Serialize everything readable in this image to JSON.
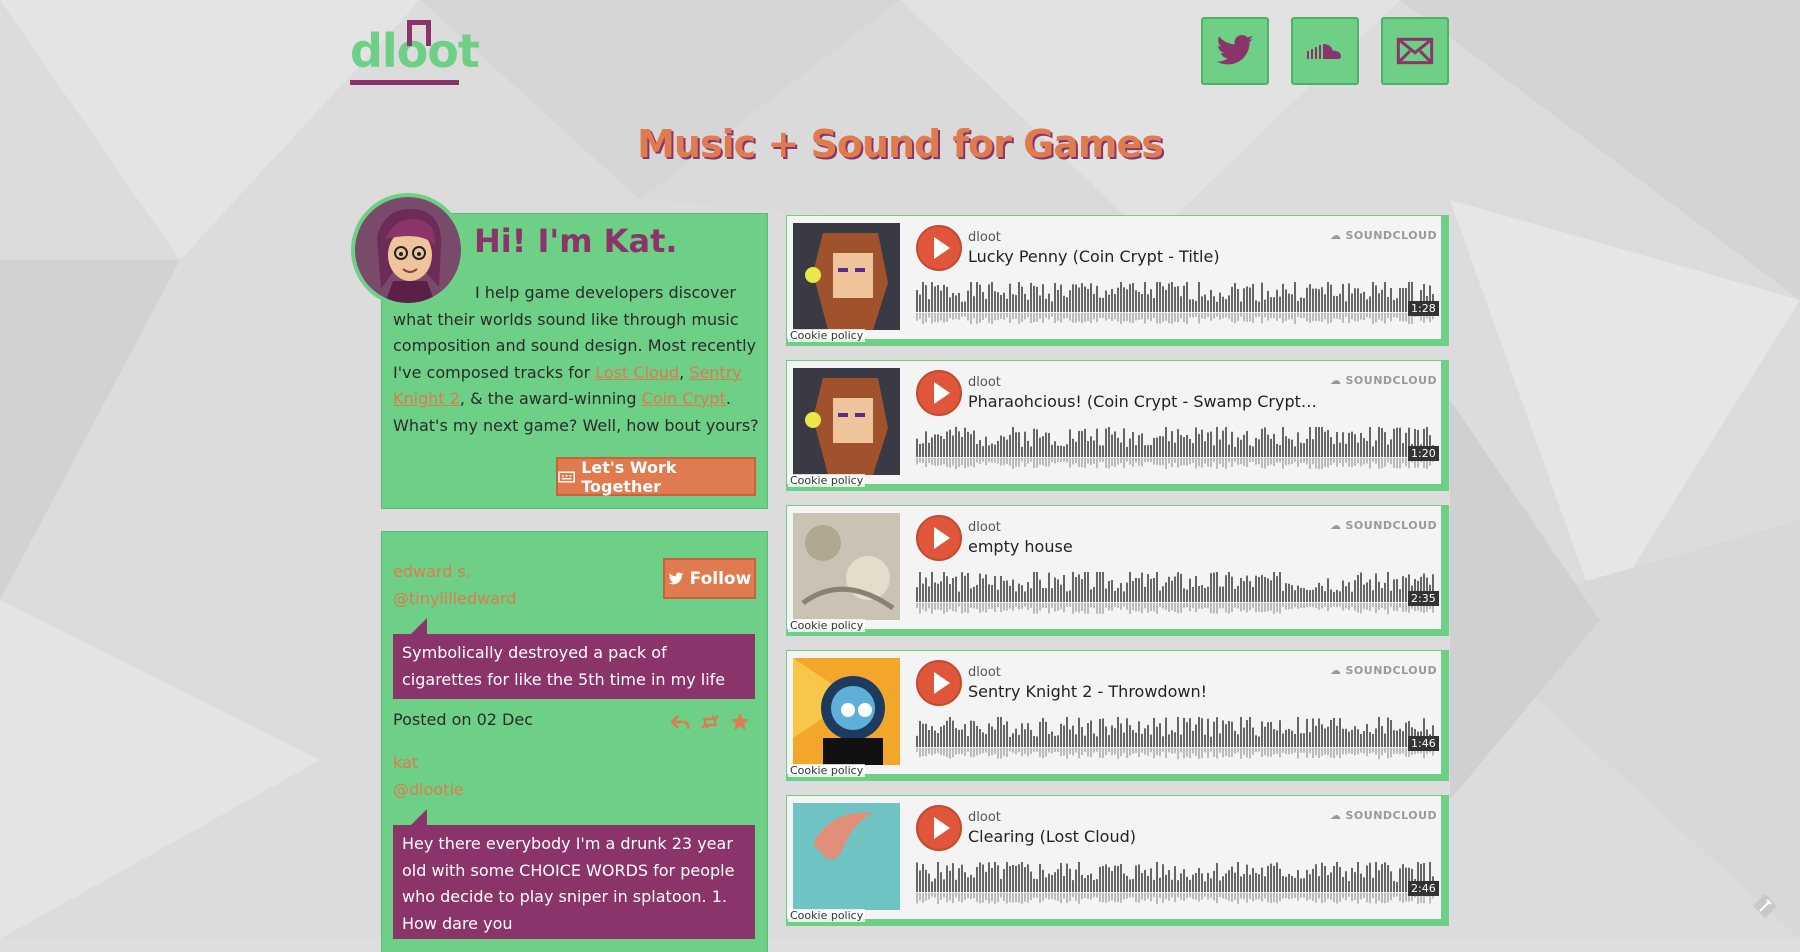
{
  "logo": {
    "text": "dloot"
  },
  "social": {
    "twitter": {
      "icon": "twitter-icon"
    },
    "soundcloud": {
      "icon": "soundcloud-icon"
    },
    "email": {
      "icon": "mail-icon"
    }
  },
  "headline": "Music + Sound for Games",
  "intro": {
    "greeting": "Hi! I'm Kat.",
    "text_before": "I help game developers discover what their worlds sound like through music composition and sound design. Most recently I've composed tracks for ",
    "link1": "Lost Cloud",
    "sep1": ", ",
    "link2": "Sentry Knight 2",
    "sep2": ", & the award-winning ",
    "link3": "Coin Crypt",
    "text_after": ". What's my next game? Well, how bout yours?",
    "cta": "Let's Work Together"
  },
  "feed": {
    "follow_label": "Follow",
    "tweets": [
      {
        "name": "edward s.",
        "handle": "@tinylilledward",
        "text": "Symbolically destroyed a pack of cigarettes for like the 5th time in my life",
        "posted": "Posted on 02 Dec"
      },
      {
        "name": "kat",
        "handle": "@dlootie",
        "text": "Hey there everybody I'm a drunk 23 year old with some CHOICE WORDS for people who decide to play sniper in splatoon. 1. How dare you"
      }
    ]
  },
  "tracks": [
    {
      "user": "dloot",
      "title": "Lucky Penny (Coin Crypt - Title)",
      "duration": "1:28",
      "brand": "SOUNDCLOUD",
      "cookie": "Cookie policy"
    },
    {
      "user": "dloot",
      "title": "Pharaohcious! (Coin Crypt - Swamp Crypt The...",
      "duration": "1:20",
      "brand": "SOUNDCLOUD",
      "cookie": "Cookie policy"
    },
    {
      "user": "dloot",
      "title": "empty house",
      "duration": "2:35",
      "brand": "SOUNDCLOUD",
      "cookie": "Cookie policy"
    },
    {
      "user": "dloot",
      "title": "Sentry Knight 2 - Throwdown!",
      "duration": "1:46",
      "brand": "SOUNDCLOUD",
      "cookie": "Cookie policy"
    },
    {
      "user": "dloot",
      "title": "Clearing (Lost Cloud)",
      "duration": "2:46",
      "brand": "SOUNDCLOUD",
      "cookie": "Cookie policy"
    }
  ],
  "colors": {
    "green": "#6ecf86",
    "plum": "#8b3469",
    "orange": "#e07a4f"
  }
}
